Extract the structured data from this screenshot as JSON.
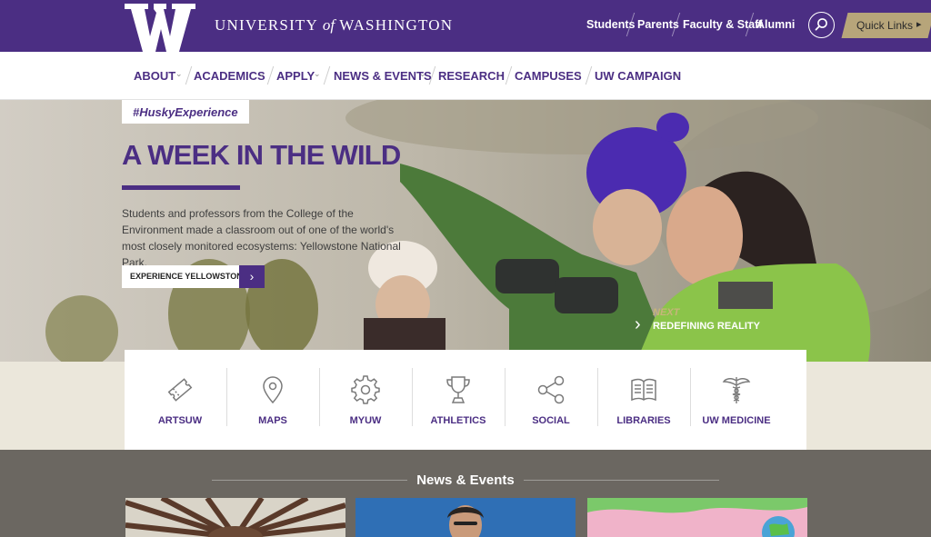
{
  "header": {
    "wordmark_a": "UNIVERSITY",
    "wordmark_of": "of",
    "wordmark_b": "WASHINGTON",
    "audience": [
      "Students",
      "Parents",
      "Faculty & Staff",
      "Alumni"
    ],
    "search_icon": "search-icon",
    "quick_links": "Quick Links",
    "quick_links_arrow": "▸"
  },
  "nav": {
    "items": [
      "ABOUT",
      "ACADEMICS",
      "APPLY",
      "NEWS & EVENTS",
      "RESEARCH",
      "CAMPUSES",
      "UW CAMPAIGN"
    ],
    "chevron": "⌄"
  },
  "hero": {
    "tag": "#HuskyExperience",
    "title": "A WEEK IN THE WILD",
    "description": "Students and professors from the College of the Environment made a classroom out of one of the world's most closely monitored ecosystems: Yellowstone National Park.",
    "cta": "EXPERIENCE YELLOWSTONE",
    "cta_arrow": "›",
    "next_label": "NEXT",
    "next_title": "REDEFINING REALITY",
    "next_chevron": "›"
  },
  "quick_links": [
    {
      "label": "ARTSUW",
      "icon": "ticket-icon"
    },
    {
      "label": "MAPS",
      "icon": "map-pin-icon"
    },
    {
      "label": "MYUW",
      "icon": "gear-icon"
    },
    {
      "label": "ATHLETICS",
      "icon": "trophy-icon"
    },
    {
      "label": "SOCIAL",
      "icon": "share-icon"
    },
    {
      "label": "LIBRARIES",
      "icon": "book-icon"
    },
    {
      "label": "UW MEDICINE",
      "icon": "caduceus-icon"
    }
  ],
  "news": {
    "title": "News & Events"
  },
  "colors": {
    "purple": "#4b2e83",
    "gold": "#b7a57a",
    "band": "#ebe7db"
  }
}
